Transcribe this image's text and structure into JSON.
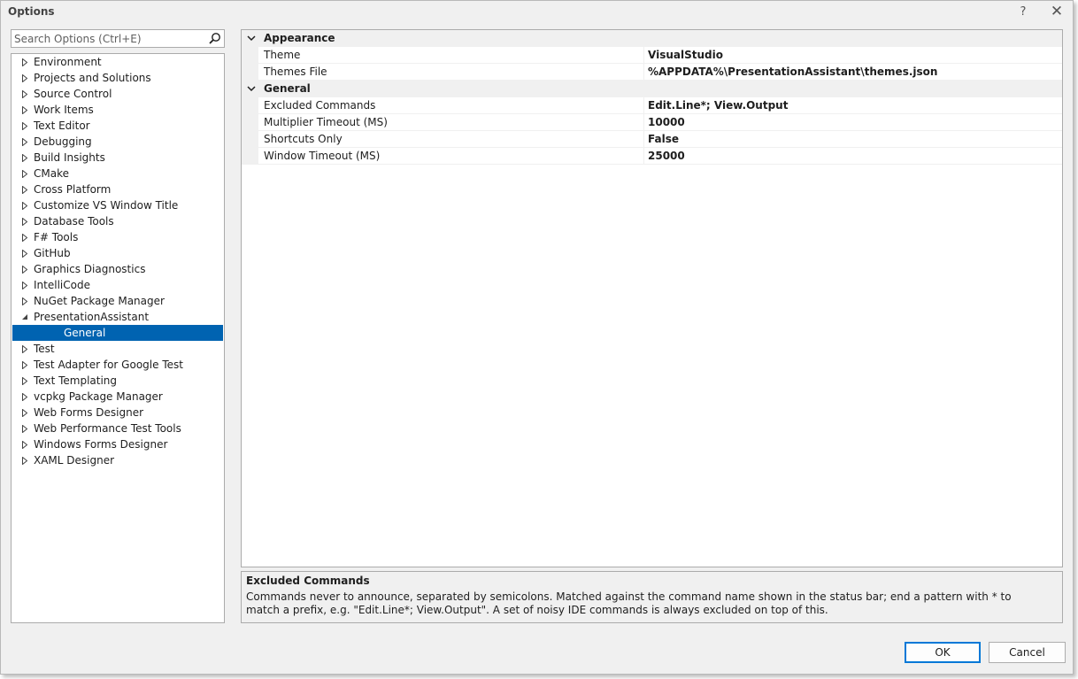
{
  "window": {
    "title": "Options",
    "help_glyph": "?",
    "close_glyph": "✕"
  },
  "search": {
    "placeholder": "Search Options (Ctrl+E)"
  },
  "tree": {
    "items": [
      {
        "label": "Environment",
        "expanded": false
      },
      {
        "label": "Projects and Solutions",
        "expanded": false
      },
      {
        "label": "Source Control",
        "expanded": false
      },
      {
        "label": "Work Items",
        "expanded": false
      },
      {
        "label": "Text Editor",
        "expanded": false
      },
      {
        "label": "Debugging",
        "expanded": false
      },
      {
        "label": "Build Insights",
        "expanded": false
      },
      {
        "label": "CMake",
        "expanded": false
      },
      {
        "label": "Cross Platform",
        "expanded": false
      },
      {
        "label": "Customize VS Window Title",
        "expanded": false
      },
      {
        "label": "Database Tools",
        "expanded": false
      },
      {
        "label": "F# Tools",
        "expanded": false
      },
      {
        "label": "GitHub",
        "expanded": false
      },
      {
        "label": "Graphics Diagnostics",
        "expanded": false
      },
      {
        "label": "IntelliCode",
        "expanded": false
      },
      {
        "label": "NuGet Package Manager",
        "expanded": false
      },
      {
        "label": "PresentationAssistant",
        "expanded": true
      },
      {
        "label": "General",
        "child": true,
        "selected": true
      },
      {
        "label": "Test",
        "expanded": false
      },
      {
        "label": "Test Adapter for Google Test",
        "expanded": false
      },
      {
        "label": "Text Templating",
        "expanded": false
      },
      {
        "label": "vcpkg Package Manager",
        "expanded": false
      },
      {
        "label": "Web Forms Designer",
        "expanded": false
      },
      {
        "label": "Web Performance Test Tools",
        "expanded": false
      },
      {
        "label": "Windows Forms Designer",
        "expanded": false
      },
      {
        "label": "XAML Designer",
        "expanded": false
      }
    ]
  },
  "grid": {
    "categories": [
      {
        "label": "Appearance",
        "properties": [
          {
            "name": "Theme",
            "value": "VisualStudio"
          },
          {
            "name": "Themes File",
            "value": "%APPDATA%\\PresentationAssistant\\themes.json"
          }
        ]
      },
      {
        "label": "General",
        "properties": [
          {
            "name": "Excluded Commands",
            "value": "Edit.Line*; View.Output"
          },
          {
            "name": "Multiplier Timeout (MS)",
            "value": "10000"
          },
          {
            "name": "Shortcuts Only",
            "value": "False"
          },
          {
            "name": "Window Timeout (MS)",
            "value": "25000"
          }
        ]
      }
    ]
  },
  "description": {
    "title": "Excluded Commands",
    "text": "Commands never to announce, separated by semicolons. Matched against the command name shown in the status bar; end a pattern with * to match a prefix, e.g. \"Edit.Line*; View.Output\". A set of noisy IDE commands is always excluded on top of this."
  },
  "buttons": {
    "ok_label": "OK",
    "cancel_label": "Cancel"
  },
  "colors": {
    "selection": "#0063b1",
    "ok_border": "#0078d7",
    "panel_bg": "#f0f0f0"
  }
}
